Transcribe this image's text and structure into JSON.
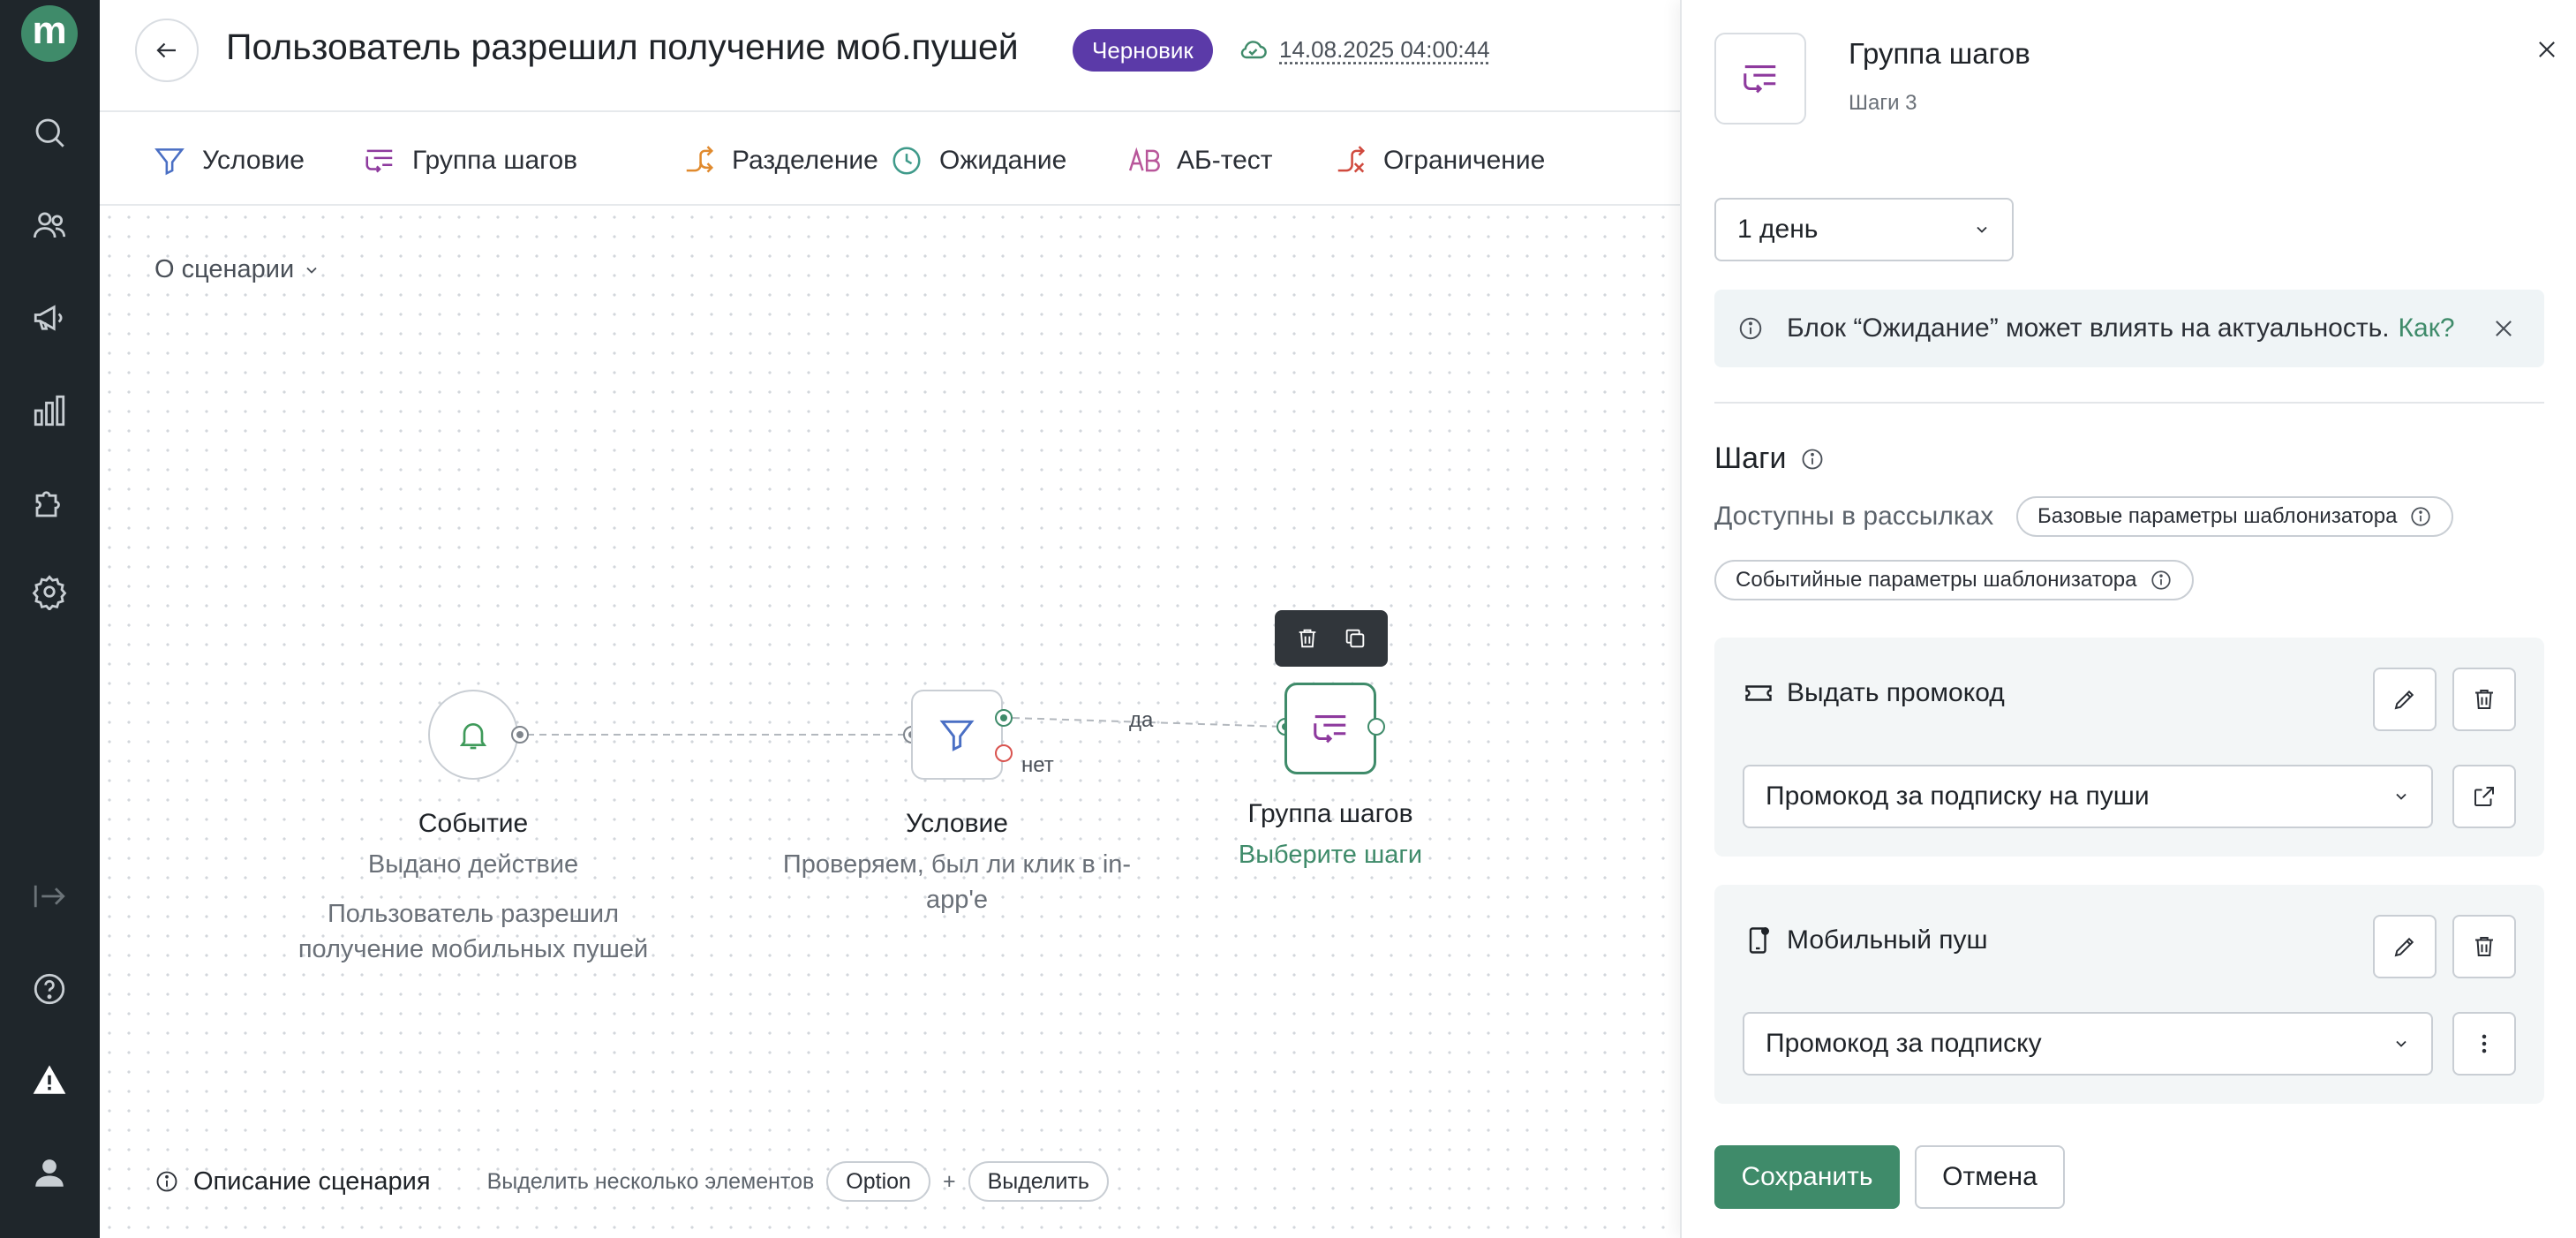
{
  "header": {
    "title": "Пользователь разрешил получение моб.пушей",
    "status_badge": "Черновик",
    "saved_at": "14.08.2025 04:00:44"
  },
  "toolbar": {
    "items": [
      {
        "label": "Условие",
        "icon": "filter-icon"
      },
      {
        "label": "Группа шагов",
        "icon": "step-group-icon"
      },
      {
        "label": "Разделение",
        "icon": "split-icon"
      },
      {
        "label": "Ожидание",
        "icon": "clock-icon"
      },
      {
        "label": "АБ-тест",
        "icon": "ab-test-icon"
      },
      {
        "label": "Ограничение",
        "icon": "limit-icon"
      }
    ]
  },
  "canvas": {
    "about_label": "О сценарии",
    "nodes": {
      "event": {
        "title": "Событие",
        "subtitle": "Выдано действие",
        "description": "Пользователь разрешил получение мобильных пушей"
      },
      "condition": {
        "title": "Условие",
        "subtitle": "Проверяем, был ли клик в in-app'e"
      },
      "group": {
        "title": "Группа шагов",
        "link": "Выберите шаги"
      }
    },
    "edge_labels": {
      "yes": "да",
      "no": "нет"
    },
    "footer": {
      "description_label": "Описание сценария",
      "hint": "Выделить несколько элементов",
      "key_option": "Option",
      "plus": "+",
      "key_select": "Выделить"
    }
  },
  "panel": {
    "title": "Группа шагов",
    "subtitle": "Шаги 3",
    "delay_value": "1 день",
    "notice": {
      "text": "Блок “Ожидание” может влиять на актуальность.",
      "link": "Как?"
    },
    "steps_heading": "Шаги",
    "available_label": "Доступны в рассылках",
    "chips": [
      "Базовые параметры шаблонизатора",
      "Событийные параметры шаблонизатора"
    ],
    "steps": [
      {
        "name": "Выдать промокод",
        "icon": "coupon-icon",
        "selected": "Промокод за подписку на пуши",
        "extra_action": "external-link-icon"
      },
      {
        "name": "Мобильный пуш",
        "icon": "mobile-push-icon",
        "selected": "Промокод за подписку",
        "extra_action": "more-vertical-icon"
      }
    ],
    "save_label": "Сохранить",
    "cancel_label": "Отмена"
  },
  "colors": {
    "rail_bg": "#1f262b",
    "accent_green": "#3f8b6a",
    "badge_purple": "#5b3aa8",
    "danger_red": "#d9534f",
    "notice_bg": "#eff4f6"
  }
}
